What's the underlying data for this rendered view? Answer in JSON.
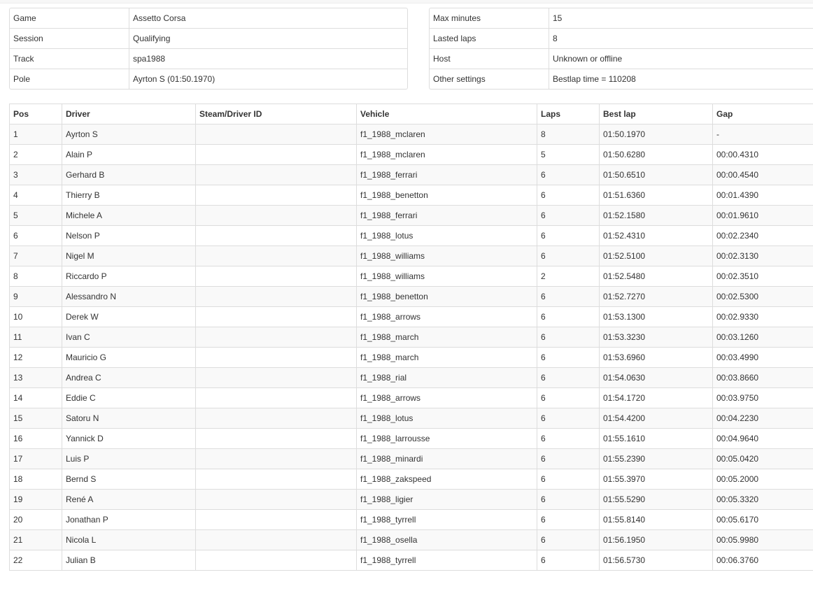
{
  "session_info": {
    "left": [
      {
        "label": "Game",
        "value": "Assetto Corsa"
      },
      {
        "label": "Session",
        "value": "Qualifying"
      },
      {
        "label": "Track",
        "value": "spa1988"
      },
      {
        "label": "Pole",
        "value": "Ayrton S (01:50.1970)"
      }
    ],
    "right": [
      {
        "label": "Max minutes",
        "value": "15"
      },
      {
        "label": "Lasted laps",
        "value": "8"
      },
      {
        "label": "Host",
        "value": "Unknown or offline"
      },
      {
        "label": "Other settings",
        "value": "Bestlap time = 110208"
      }
    ]
  },
  "results": {
    "headers": [
      "Pos",
      "Driver",
      "Steam/Driver ID",
      "Vehicle",
      "Laps",
      "Best lap",
      "Gap"
    ],
    "rows": [
      {
        "pos": "1",
        "driver": "Ayrton S",
        "steam_id": "",
        "vehicle": "f1_1988_mclaren",
        "laps": "8",
        "best_lap": "01:50.1970",
        "gap": "-"
      },
      {
        "pos": "2",
        "driver": "Alain P",
        "steam_id": "",
        "vehicle": "f1_1988_mclaren",
        "laps": "5",
        "best_lap": "01:50.6280",
        "gap": "00:00.4310"
      },
      {
        "pos": "3",
        "driver": "Gerhard B",
        "steam_id": "",
        "vehicle": "f1_1988_ferrari",
        "laps": "6",
        "best_lap": "01:50.6510",
        "gap": "00:00.4540"
      },
      {
        "pos": "4",
        "driver": "Thierry B",
        "steam_id": "",
        "vehicle": "f1_1988_benetton",
        "laps": "6",
        "best_lap": "01:51.6360",
        "gap": "00:01.4390"
      },
      {
        "pos": "5",
        "driver": "Michele A",
        "steam_id": "",
        "vehicle": "f1_1988_ferrari",
        "laps": "6",
        "best_lap": "01:52.1580",
        "gap": "00:01.9610"
      },
      {
        "pos": "6",
        "driver": "Nelson P",
        "steam_id": "",
        "vehicle": "f1_1988_lotus",
        "laps": "6",
        "best_lap": "01:52.4310",
        "gap": "00:02.2340"
      },
      {
        "pos": "7",
        "driver": "Nigel M",
        "steam_id": "",
        "vehicle": "f1_1988_williams",
        "laps": "6",
        "best_lap": "01:52.5100",
        "gap": "00:02.3130"
      },
      {
        "pos": "8",
        "driver": "Riccardo P",
        "steam_id": "",
        "vehicle": "f1_1988_williams",
        "laps": "2",
        "best_lap": "01:52.5480",
        "gap": "00:02.3510"
      },
      {
        "pos": "9",
        "driver": "Alessandro N",
        "steam_id": "",
        "vehicle": "f1_1988_benetton",
        "laps": "6",
        "best_lap": "01:52.7270",
        "gap": "00:02.5300"
      },
      {
        "pos": "10",
        "driver": "Derek W",
        "steam_id": "",
        "vehicle": "f1_1988_arrows",
        "laps": "6",
        "best_lap": "01:53.1300",
        "gap": "00:02.9330"
      },
      {
        "pos": "11",
        "driver": "Ivan C",
        "steam_id": "",
        "vehicle": "f1_1988_march",
        "laps": "6",
        "best_lap": "01:53.3230",
        "gap": "00:03.1260"
      },
      {
        "pos": "12",
        "driver": "Mauricio G",
        "steam_id": "",
        "vehicle": "f1_1988_march",
        "laps": "6",
        "best_lap": "01:53.6960",
        "gap": "00:03.4990"
      },
      {
        "pos": "13",
        "driver": "Andrea C",
        "steam_id": "",
        "vehicle": "f1_1988_rial",
        "laps": "6",
        "best_lap": "01:54.0630",
        "gap": "00:03.8660"
      },
      {
        "pos": "14",
        "driver": "Eddie C",
        "steam_id": "",
        "vehicle": "f1_1988_arrows",
        "laps": "6",
        "best_lap": "01:54.1720",
        "gap": "00:03.9750"
      },
      {
        "pos": "15",
        "driver": "Satoru N",
        "steam_id": "",
        "vehicle": "f1_1988_lotus",
        "laps": "6",
        "best_lap": "01:54.4200",
        "gap": "00:04.2230"
      },
      {
        "pos": "16",
        "driver": "Yannick D",
        "steam_id": "",
        "vehicle": "f1_1988_larrousse",
        "laps": "6",
        "best_lap": "01:55.1610",
        "gap": "00:04.9640"
      },
      {
        "pos": "17",
        "driver": "Luis P",
        "steam_id": "",
        "vehicle": "f1_1988_minardi",
        "laps": "6",
        "best_lap": "01:55.2390",
        "gap": "00:05.0420"
      },
      {
        "pos": "18",
        "driver": "Bernd S",
        "steam_id": "",
        "vehicle": "f1_1988_zakspeed",
        "laps": "6",
        "best_lap": "01:55.3970",
        "gap": "00:05.2000"
      },
      {
        "pos": "19",
        "driver": "René A",
        "steam_id": "",
        "vehicle": "f1_1988_ligier",
        "laps": "6",
        "best_lap": "01:55.5290",
        "gap": "00:05.3320"
      },
      {
        "pos": "20",
        "driver": "Jonathan P",
        "steam_id": "",
        "vehicle": "f1_1988_tyrrell",
        "laps": "6",
        "best_lap": "01:55.8140",
        "gap": "00:05.6170"
      },
      {
        "pos": "21",
        "driver": "Nicola L",
        "steam_id": "",
        "vehicle": "f1_1988_osella",
        "laps": "6",
        "best_lap": "01:56.1950",
        "gap": "00:05.9980"
      },
      {
        "pos": "22",
        "driver": "Julian B",
        "steam_id": "",
        "vehicle": "f1_1988_tyrrell",
        "laps": "6",
        "best_lap": "01:56.5730",
        "gap": "00:06.3760"
      }
    ]
  }
}
